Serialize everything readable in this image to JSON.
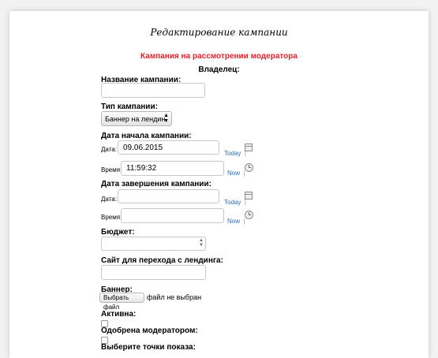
{
  "page_title": "Редактирование кампании",
  "status_text": "Кампания на рассмотрении модератора",
  "owner_label": "Владелец:",
  "campaign_name": {
    "label": "Название кампании:",
    "value": ""
  },
  "campaign_type": {
    "label": "Тип кампании:",
    "selected": "Баннер на лендин"
  },
  "start": {
    "label": "Дата начала кампании:",
    "date_label": "Дата:",
    "date_value": "09.06.2015",
    "today_link": "Today",
    "time_label": "Время:",
    "time_value": "11:59:32",
    "now_link": "Now"
  },
  "end": {
    "label": "Дата завершения кампании:",
    "date_label": "Дата:",
    "date_value": "",
    "today_link": "Today",
    "time_label": "Время:",
    "time_value": "",
    "now_link": "Now"
  },
  "separator": "|",
  "budget": {
    "label": "Бюджет:",
    "value": ""
  },
  "landing_site": {
    "label": "Сайт для перехода с лендинга:",
    "value": ""
  },
  "banner": {
    "label": "Баннер:",
    "button": "Выбрать файл",
    "status": "файл не выбран"
  },
  "active": {
    "label": "Активна:",
    "checked": false
  },
  "approved": {
    "label": "Одобрена модератором:",
    "checked": false
  },
  "display_points": {
    "label": "Выберите точки показа:"
  },
  "icons": [
    "calendar-icon",
    "clock-icon"
  ]
}
